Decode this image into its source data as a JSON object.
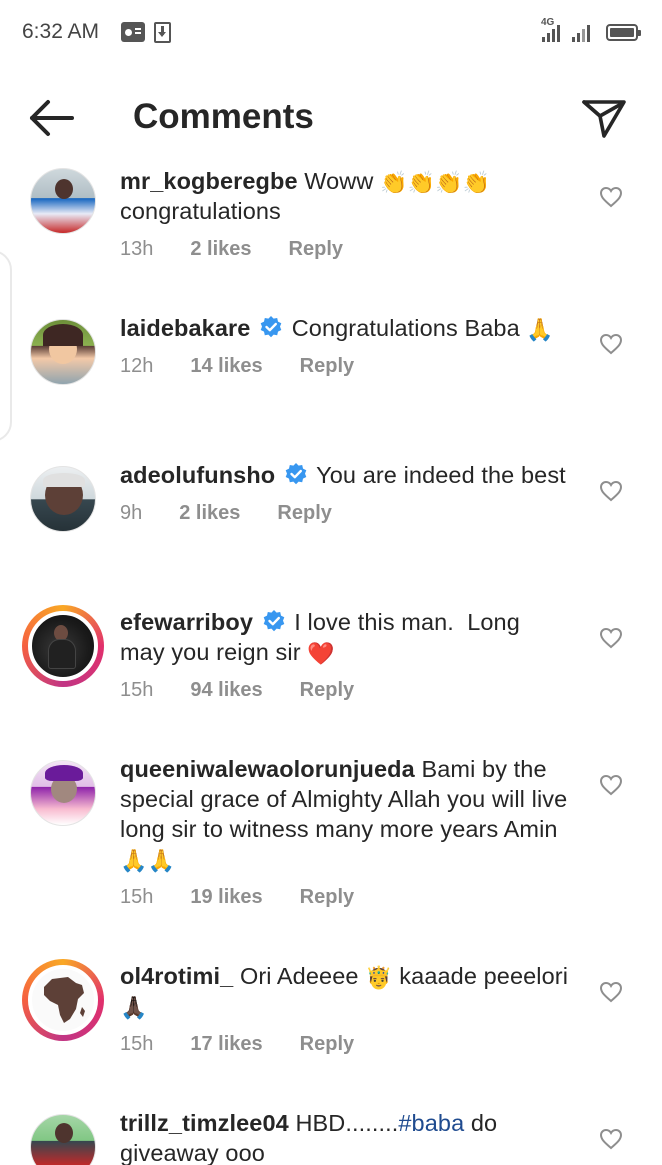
{
  "status_bar": {
    "time": "6:32 AM",
    "network": "4G",
    "icons": [
      "radio-icon",
      "download-icon",
      "signal-icon",
      "signal-icon",
      "battery-icon"
    ]
  },
  "header": {
    "title": "Comments",
    "back_icon": "arrow-left-icon",
    "share_icon": "paper-plane-icon"
  },
  "colors": {
    "verified": "#3897f0",
    "hashtag": "#1f4b8f",
    "meta": "#8e8e8e",
    "text": "#262626"
  },
  "comments": [
    {
      "username": "mr_kogberegbe",
      "verified": false,
      "story_ring": false,
      "text_parts": [
        "Woww ",
        "👏👏👏👏",
        " congratulations"
      ],
      "time": "13h",
      "likes": "2 likes",
      "reply": "Reply"
    },
    {
      "username": "laidebakare",
      "verified": true,
      "story_ring": false,
      "text_parts": [
        "Congratulations Baba ",
        "🙏"
      ],
      "time": "12h",
      "likes": "14 likes",
      "reply": "Reply"
    },
    {
      "username": "adeolufunsho",
      "verified": true,
      "story_ring": false,
      "text_parts": [
        "You are indeed the best"
      ],
      "time": "9h",
      "likes": "2 likes",
      "reply": "Reply"
    },
    {
      "username": "efewarriboy",
      "verified": true,
      "story_ring": true,
      "text_parts": [
        "I love this man.  Long may you reign sir ",
        "❤️"
      ],
      "time": "15h",
      "likes": "94 likes",
      "reply": "Reply"
    },
    {
      "username": "queeniwalewaolorunjueda",
      "verified": false,
      "story_ring": false,
      "text_parts": [
        "Bami by the special grace of Almighty Allah you will live long sir to witness many more years Amin ",
        "🙏🙏"
      ],
      "time": "15h",
      "likes": "19 likes",
      "reply": "Reply"
    },
    {
      "username": "ol4rotimi_",
      "verified": false,
      "story_ring": true,
      "text_parts": [
        "Ori Adeeee ",
        "🤴",
        " kaaade peeelori ",
        "🙏🏿"
      ],
      "time": "15h",
      "likes": "17 likes",
      "reply": "Reply"
    },
    {
      "username": "trillz_timzlee04",
      "verified": false,
      "story_ring": false,
      "text_parts": [
        "HBD........",
        "#baba",
        " do giveaway ooo"
      ],
      "time": "",
      "likes": "",
      "reply": ""
    }
  ]
}
